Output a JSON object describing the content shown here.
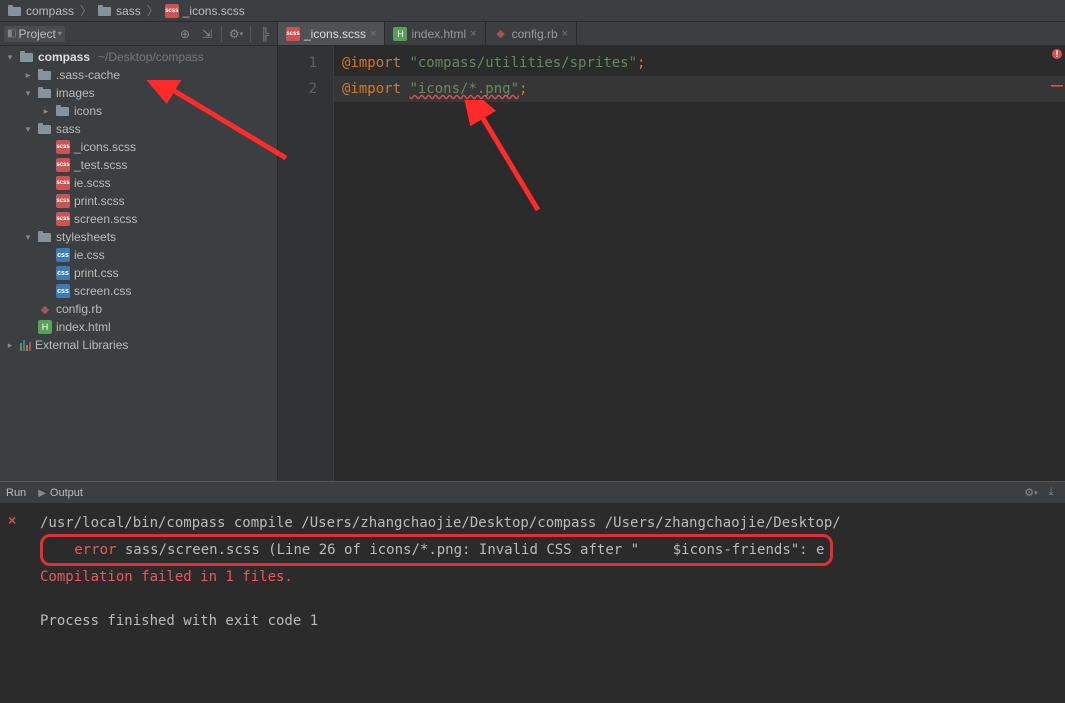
{
  "breadcrumb": [
    {
      "icon": "folder",
      "label": "compass"
    },
    {
      "icon": "folder",
      "label": "sass"
    },
    {
      "icon": "scss",
      "label": "_icons.scss"
    }
  ],
  "sidebar": {
    "title": "Project",
    "root": {
      "label": "compass",
      "hint": "~/Desktop/compass"
    },
    "tree": [
      {
        "depth": 1,
        "arrow": "right",
        "icon": "folder",
        "label": ".sass-cache"
      },
      {
        "depth": 1,
        "arrow": "down",
        "icon": "folder",
        "label": "images"
      },
      {
        "depth": 2,
        "arrow": "right",
        "icon": "folder",
        "label": "icons"
      },
      {
        "depth": 1,
        "arrow": "down",
        "icon": "folder",
        "label": "sass"
      },
      {
        "depth": 2,
        "arrow": "",
        "icon": "scss",
        "label": "_icons.scss"
      },
      {
        "depth": 2,
        "arrow": "",
        "icon": "scss",
        "label": "_test.scss"
      },
      {
        "depth": 2,
        "arrow": "",
        "icon": "scss",
        "label": "ie.scss"
      },
      {
        "depth": 2,
        "arrow": "",
        "icon": "scss",
        "label": "print.scss"
      },
      {
        "depth": 2,
        "arrow": "",
        "icon": "scss",
        "label": "screen.scss"
      },
      {
        "depth": 1,
        "arrow": "down",
        "icon": "folder",
        "label": "stylesheets"
      },
      {
        "depth": 2,
        "arrow": "",
        "icon": "css",
        "label": "ie.css"
      },
      {
        "depth": 2,
        "arrow": "",
        "icon": "css",
        "label": "print.css"
      },
      {
        "depth": 2,
        "arrow": "",
        "icon": "css",
        "label": "screen.css"
      },
      {
        "depth": 1,
        "arrow": "",
        "icon": "rb",
        "label": "config.rb"
      },
      {
        "depth": 1,
        "arrow": "",
        "icon": "html",
        "label": "index.html"
      }
    ],
    "external": "External Libraries"
  },
  "tabs": [
    {
      "icon": "scss",
      "label": "_icons.scss",
      "active": true
    },
    {
      "icon": "html",
      "label": "index.html",
      "active": false
    },
    {
      "icon": "rb",
      "label": "config.rb",
      "active": false
    }
  ],
  "editor": {
    "lines": [
      {
        "n": "1",
        "kw": "@import",
        "str": "\"compass/utilities/sprites\"",
        "semi": ";"
      },
      {
        "n": "2",
        "kw": "@import",
        "str": "\"icons/*.png\"",
        "semi": ";"
      }
    ]
  },
  "terminal": {
    "tab_run": "Run",
    "tab_output": "Output",
    "cmd": "/usr/local/bin/compass compile /Users/zhangchaojie/Desktop/compass /Users/zhangchaojie/Desktop/",
    "err_label": "error",
    "err_rest": " sass/screen.scss (Line 26 of icons/*.png: Invalid CSS after \"    $icons-friends\": e",
    "fail": "Compilation failed in 1 files.",
    "exit": "Process finished with exit code 1"
  }
}
